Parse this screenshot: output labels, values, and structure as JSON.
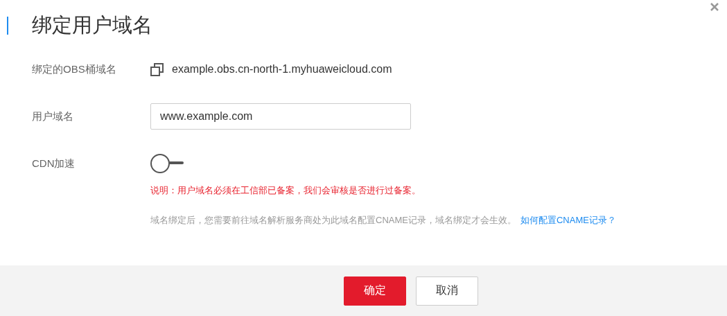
{
  "dialog": {
    "title": "绑定用户域名"
  },
  "fields": [
    {
      "kind": "text",
      "label": "绑定的OBS桶域名",
      "value": "example.obs.cn-north-1.myhuaweicloud.com"
    },
    {
      "kind": "input",
      "label": "用户域名",
      "value": "www.example.com"
    },
    {
      "kind": "switch",
      "label": "CDN加速",
      "on": false
    }
  ],
  "notice": "说明：用户域名必须在工信部已备案，我们会审核是否进行过备案。",
  "hint": {
    "text": "域名绑定后，您需要前往域名解析服务商处为此域名配置CNAME记录，域名绑定才会生效。",
    "link": "如何配置CNAME记录？"
  },
  "buttons": [
    {
      "label": "确定",
      "primary": true
    },
    {
      "label": "取消",
      "primary": false
    }
  ]
}
